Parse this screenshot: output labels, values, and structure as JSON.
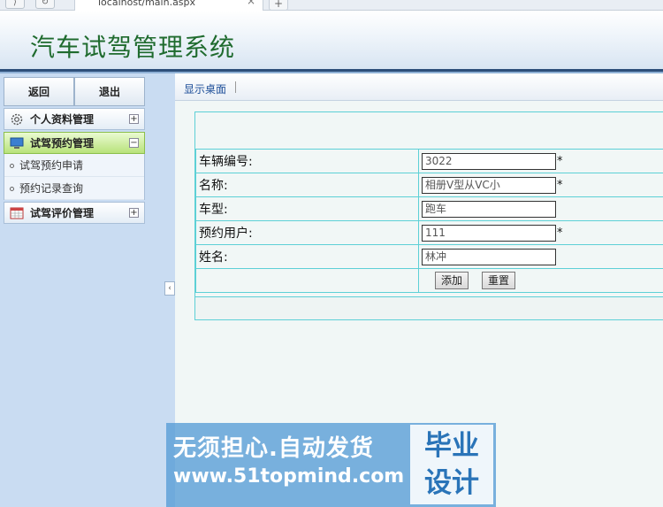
{
  "browser": {
    "back_glyph": "⟩",
    "reload_glyph": "↻",
    "tab_title": "localhost/main.aspx",
    "tab_close_glyph": "×",
    "new_tab_glyph": "+"
  },
  "header": {
    "title": "汽车试驾管理系统"
  },
  "sidebar": {
    "buttons": {
      "back_label": "返回",
      "logout_label": "退出"
    },
    "menus": [
      {
        "label": "个人资料管理",
        "icon": "gear-icon",
        "toggle": "+"
      },
      {
        "label": "试驾预约管理",
        "icon": "monitor-icon",
        "toggle": "−",
        "active": true
      },
      {
        "label": "试驾评价管理",
        "icon": "calendar-icon",
        "toggle": "+"
      }
    ],
    "submenu": [
      {
        "label": "试驾预约申请"
      },
      {
        "label": "预约记录查询"
      }
    ],
    "collapse_glyph": "‹"
  },
  "main": {
    "tab_label": "显示桌面",
    "form": {
      "rows": [
        {
          "label": "车辆编号:",
          "value": "3022",
          "required": true
        },
        {
          "label": "名称:",
          "value": "相册V型从VC小",
          "required": true
        },
        {
          "label": "车型:",
          "value": "跑车",
          "required": false
        },
        {
          "label": "预约用户:",
          "value": "111",
          "required": true
        },
        {
          "label": "姓名:",
          "value": "林冲",
          "required": false
        }
      ],
      "required_mark": "*",
      "add_label": "添加",
      "reset_label": "重置"
    }
  },
  "watermark": {
    "line1": "无须担心.自动发货",
    "line2": "www.51topmind.com",
    "badge_line1": "毕业",
    "badge_line2": "设计"
  },
  "colors": {
    "title_green": "#1f6b2e",
    "active_menu": "#b8e27a",
    "form_border": "#5dd0d6",
    "sidebar_bg": "#c9dcf2"
  }
}
